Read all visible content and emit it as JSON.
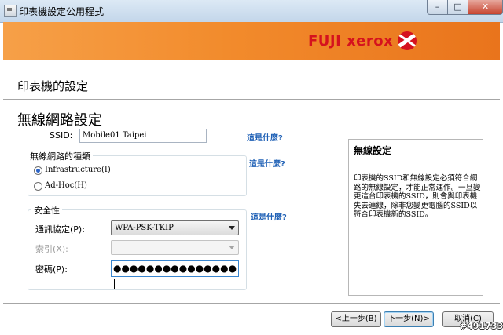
{
  "window": {
    "title": "印表機設定公用程式",
    "minimize": "–",
    "maximize": "□",
    "close": "✕"
  },
  "brand": {
    "logo_text": "FUJI xerox"
  },
  "page": {
    "heading": "印表機的設定",
    "section_title": "無線網路設定"
  },
  "ssid": {
    "label": "SSID:",
    "value": "Mobile01 Taipei",
    "help": "這是什麼?"
  },
  "network_type": {
    "legend": "無線網路的種類",
    "help": "這是什麼?",
    "options": [
      {
        "label": "Infrastructure(I)",
        "checked": true
      },
      {
        "label": "Ad-Hoc(H)",
        "checked": false
      }
    ]
  },
  "security": {
    "legend": "安全性",
    "help": "這是什麼?",
    "protocol_label": "通訊協定(P):",
    "protocol_value": "WPA-PSK-TKIP",
    "index_label": "索引(X):",
    "index_value": "",
    "password_label": "密碼(P):",
    "password_value": "●●●●●●●●●●●●●●●"
  },
  "info": {
    "title": "無線設定",
    "body": "印表機的SSID和無線設定必須符合網路的無線設定，才能正常運作。一旦變更這台印表機的SSID，則會與印表機失去連線，除非您變更電腦的SSID以符合印表機新的SSID。"
  },
  "buttons": {
    "back": "<上一步(B)",
    "next": "下一步(N)>",
    "cancel": "取消(C)"
  },
  "watermark": "#491733"
}
